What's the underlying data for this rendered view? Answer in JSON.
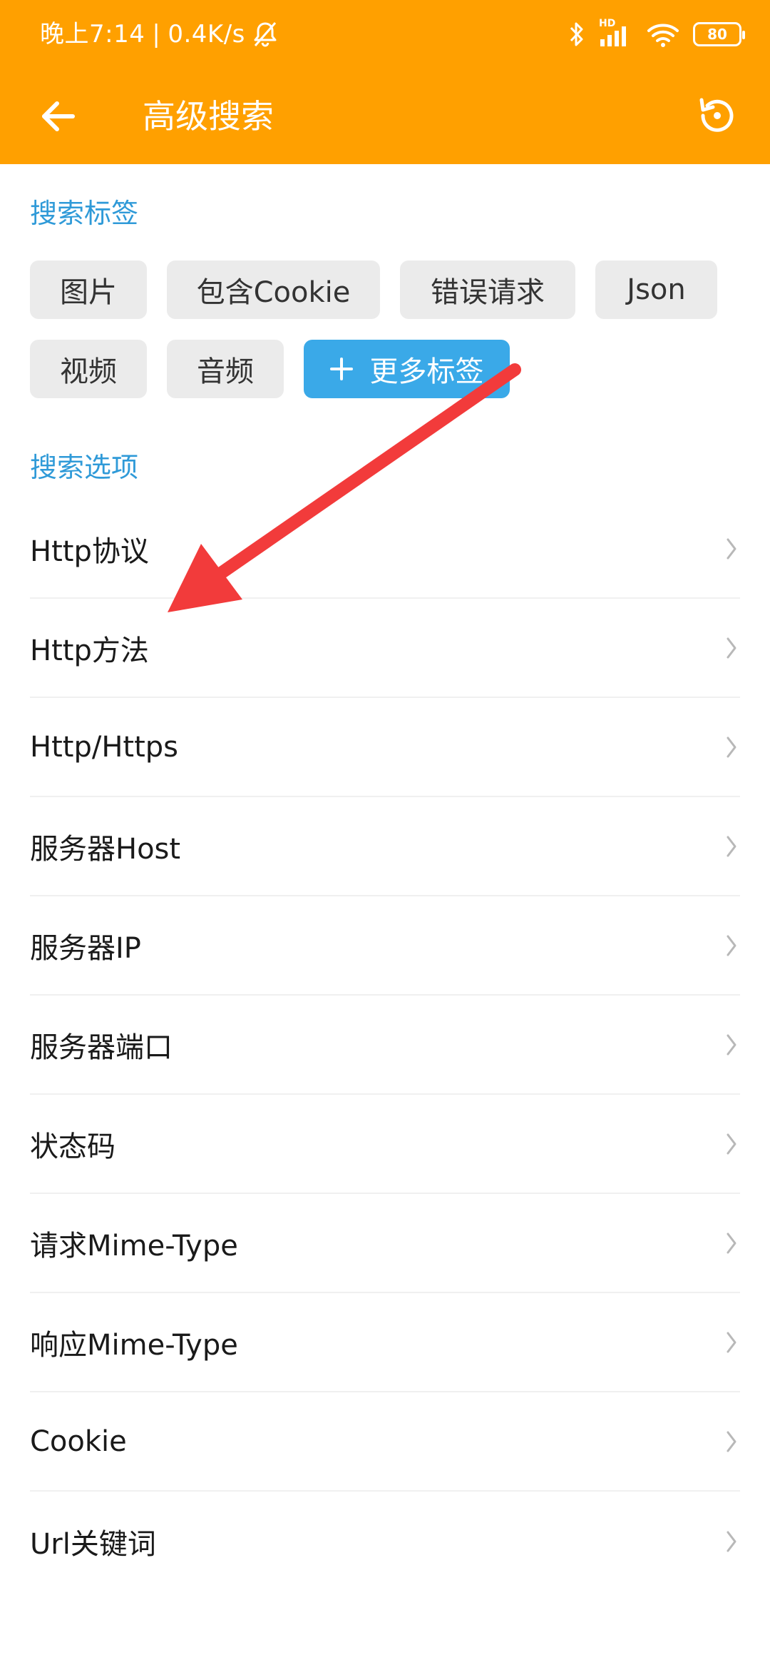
{
  "status_bar": {
    "time": "晚上7:14",
    "separator": "|",
    "speed": "0.4K/s",
    "battery": "80",
    "network_badge": "HD"
  },
  "app_bar": {
    "title": "高级搜索",
    "back_icon": "arrow-left-icon",
    "history_icon": "reset-history-icon"
  },
  "tags_section": {
    "title": "搜索标签",
    "tags": [
      "图片",
      "包含Cookie",
      "错误请求",
      "Json",
      "视频",
      "音频"
    ],
    "more_label": "更多标签"
  },
  "options_section": {
    "title": "搜索选项",
    "items": [
      "Http协议",
      "Http方法",
      "Http/Https",
      "服务器Host",
      "服务器IP",
      "服务器端口",
      "状态码",
      "请求Mime-Type",
      "响应Mime-Type",
      "Cookie",
      "Url关键词"
    ]
  },
  "colors": {
    "accent": "#FFA000",
    "section_title": "#2F9AD8",
    "more_button": "#3AA9E8",
    "annotation_arrow": "#F23B3B"
  }
}
